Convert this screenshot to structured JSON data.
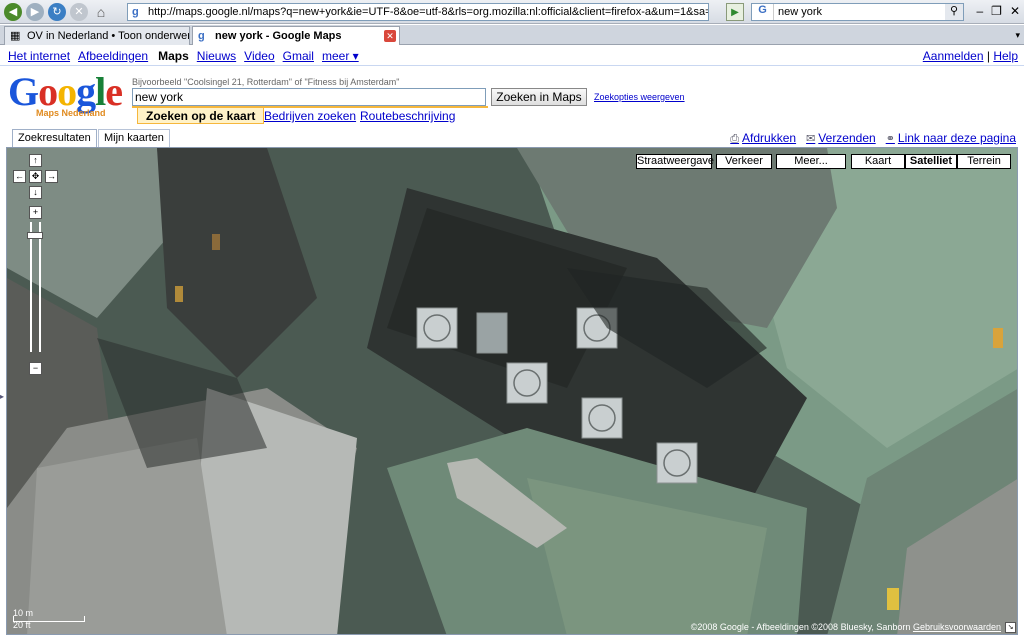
{
  "browser": {
    "url": "http://maps.google.nl/maps?q=new+york&ie=UTF-8&oe=utf-8&rls=org.mozilla:nl:official&client=firefox-a&um=1&sa=X&oi=geo",
    "search_engine_icon": "G",
    "search_query": "new york",
    "tabs": [
      {
        "label": "OV in Nederland • Toon onderwerp...",
        "icon": "forum-icon"
      },
      {
        "label": "new york - Google Maps",
        "icon": "google-icon"
      }
    ]
  },
  "gbar": {
    "links": [
      "Het internet",
      "Afbeeldingen",
      "Maps",
      "Nieuws",
      "Video",
      "Gmail",
      "meer ▾"
    ],
    "active": "Maps",
    "login": "Aanmelden",
    "separator": "|",
    "help": "Help"
  },
  "logo": {
    "text": "Google",
    "sub": "Maps Nederland"
  },
  "search": {
    "hint": "Bijvoorbeeld \"Coolsingel 21, Rotterdam\" of \"Fitness bij Amsterdam\"",
    "value": "new york",
    "button": "Zoeken in Maps",
    "options": "Zoekopties weergeven",
    "subtabs": [
      "Zoeken op de kaart",
      "Bedrijven zoeken",
      "Routebeschrijving"
    ]
  },
  "panel_tabs": [
    "Zoekresultaten",
    "Mijn kaarten"
  ],
  "actions": [
    "Afdrukken",
    "Verzenden",
    "Link naar deze pagina"
  ],
  "map": {
    "top_buttons": [
      "Straatweergave",
      "Verkeer",
      "Meer...",
      "Kaart",
      "Satelliet",
      "Terrein"
    ],
    "active_type": "Satelliet",
    "zoom_level": 0.08,
    "scale": {
      "metric": "10 m",
      "imperial": "20 ft"
    },
    "copyright": "©2008 Google - Afbeeldingen ©2008 Bluesky, Sanborn",
    "terms": "Gebruiksvoorwaarden"
  }
}
